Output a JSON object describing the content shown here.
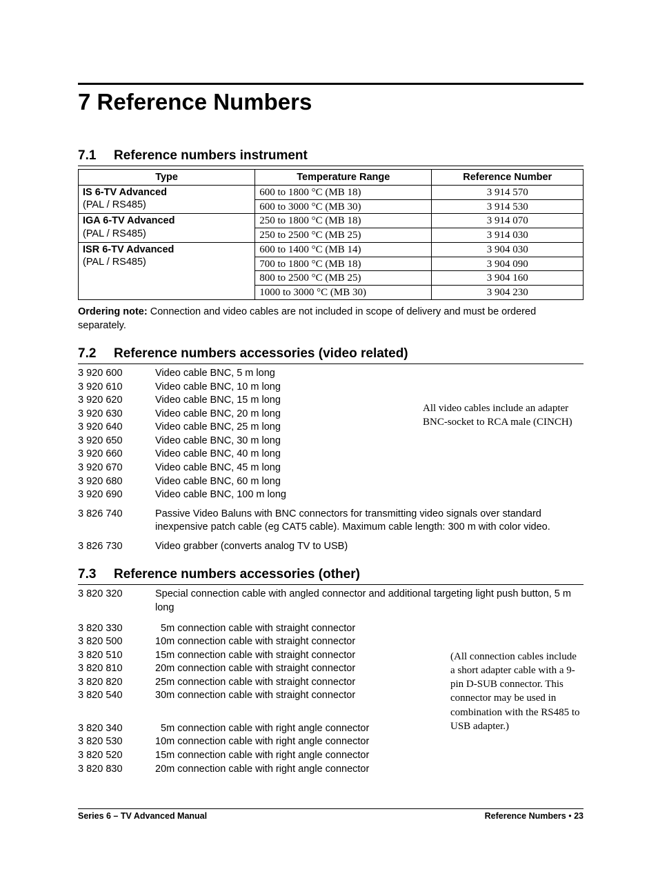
{
  "heading": "7 Reference Numbers",
  "section71": {
    "title_no": "7.1",
    "title_txt": "Reference numbers instrument",
    "headers": {
      "type": "Type",
      "range": "Temperature Range",
      "ref": "Reference Number"
    },
    "groups": [
      {
        "type_line0": "IS 6-TV Advanced",
        "type_line1": "(PAL / RS485)",
        "rows": [
          {
            "range": "600 to 1800 °C (MB 18)",
            "ref": "3 914 570"
          },
          {
            "range": "600 to 3000 °C (MB 30)",
            "ref": "3 914 530"
          }
        ]
      },
      {
        "type_line0": "IGA 6-TV Advanced",
        "type_line1": "(PAL / RS485)",
        "rows": [
          {
            "range": "250 to 1800 °C (MB 18)",
            "ref": "3 914 070"
          },
          {
            "range": "250 to 2500 °C (MB 25)",
            "ref": "3 914 030"
          }
        ]
      },
      {
        "type_line0": "ISR 6-TV Advanced",
        "type_line1": "(PAL / RS485)",
        "rows": [
          {
            "range": "600 to 1400 °C (MB 14)",
            "ref": "3 904 030"
          },
          {
            "range": "700 to 1800 °C (MB 18)",
            "ref": "3 904 090"
          },
          {
            "range": "800 to 2500 °C (MB 25)",
            "ref": "3 904 160"
          },
          {
            "range": "1000 to 3000 °C (MB 30)",
            "ref": "3 904 230"
          }
        ]
      }
    ],
    "note_label": "Ordering note:",
    "note_text": " Connection and video cables are not included in scope of delivery and must be ordered separately."
  },
  "section72": {
    "title_no": "7.2",
    "title_txt": "Reference numbers accessories (video related)",
    "items": [
      {
        "rn": "3 920 600",
        "desc": "Video cable BNC, 5 m long"
      },
      {
        "rn": "3 920 610",
        "desc": "Video cable BNC, 10 m long"
      },
      {
        "rn": "3 920 620",
        "desc": "Video cable BNC, 15 m long"
      },
      {
        "rn": "3 920 630",
        "desc": "Video cable BNC, 20 m long"
      },
      {
        "rn": "3 920 640",
        "desc": "Video cable BNC, 25 m long"
      },
      {
        "rn": "3 920 650",
        "desc": "Video cable BNC, 30 m long"
      },
      {
        "rn": "3 920 660",
        "desc": "Video cable BNC, 40 m long"
      },
      {
        "rn": "3 920 670",
        "desc": "Video cable BNC, 45 m long"
      },
      {
        "rn": "3 920 680",
        "desc": "Video cable BNC, 60 m long"
      },
      {
        "rn": "3 920 690",
        "desc": "Video cable BNC, 100 m long"
      }
    ],
    "side_note": "All video cables include an adapter BNC-socket to RCA male (CINCH)",
    "extra": [
      {
        "rn": "3 826 740",
        "desc": "Passive Video Baluns with BNC connectors for transmitting video signals over standard inexpensive patch cable (eg CAT5 cable). Maximum cable length: 300 m with color video."
      },
      {
        "rn": "3 826 730",
        "desc": "Video grabber (converts analog TV to USB)"
      }
    ]
  },
  "section73": {
    "title_no": "7.3",
    "title_txt": "Reference numbers accessories (other)",
    "first": {
      "rn": "3 820 320",
      "desc": "Special connection cable with angled connector and additional targeting light push button, 5 m long"
    },
    "straight": [
      {
        "rn": "3 820 330",
        "desc": "  5m connection cable with straight connector"
      },
      {
        "rn": "3 820 500",
        "desc": "10m connection cable with straight connector"
      },
      {
        "rn": "3 820 510",
        "desc": "15m connection cable with straight connector"
      },
      {
        "rn": "3 820 810",
        "desc": "20m connection cable with straight connector"
      },
      {
        "rn": "3 820 820",
        "desc": "25m connection cable with straight connector"
      },
      {
        "rn": "3 820 540",
        "desc": "30m connection cable with straight connector"
      }
    ],
    "angle": [
      {
        "rn": "3 820 340",
        "desc": "  5m connection cable with right angle connector"
      },
      {
        "rn": "3 820 530",
        "desc": "10m connection cable with right angle connector"
      },
      {
        "rn": "3 820 520",
        "desc": "15m connection cable with right angle connector"
      },
      {
        "rn": "3 820 830",
        "desc": "20m connection cable with right angle connector"
      }
    ],
    "side_note": "(All connection cables include a short adapter cable with a 9-pin D-SUB connector. This connector may be used in combination with the RS485 to USB adapter.)"
  },
  "footer": {
    "left": "Series 6 – TV Advanced Manual",
    "right_label": "Reference Numbers",
    "page": "23"
  }
}
